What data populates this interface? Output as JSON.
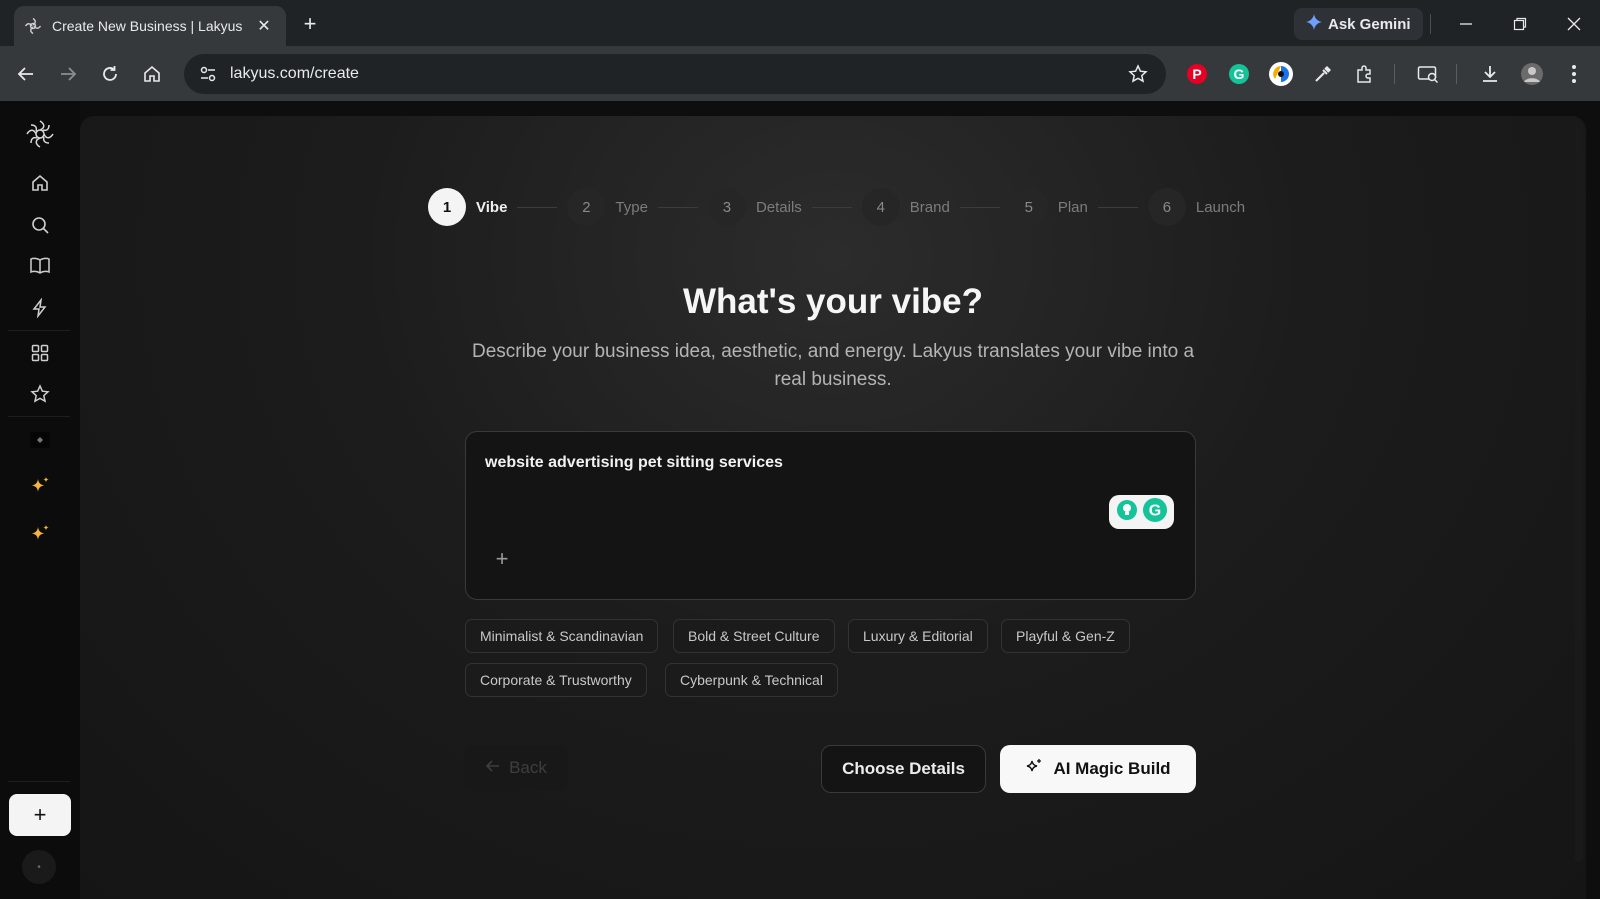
{
  "browser": {
    "tab_title": "Create New Business | Lakyus",
    "tab_close": "✕",
    "new_tab": "+",
    "ask_gemini": "Ask Gemini",
    "url": "lakyus.com/create"
  },
  "stepper": [
    {
      "number": "1",
      "label": "Vibe"
    },
    {
      "number": "2",
      "label": "Type"
    },
    {
      "number": "3",
      "label": "Details"
    },
    {
      "number": "4",
      "label": "Brand"
    },
    {
      "number": "5",
      "label": "Plan"
    },
    {
      "number": "6",
      "label": "Launch"
    }
  ],
  "main": {
    "heading": "What's your vibe?",
    "subheading": "Describe your business idea, aesthetic, and energy. Lakyus translates your vibe into a real business.",
    "prompt_value": "website advertising pet sitting services",
    "attach_label": "+",
    "chips": [
      "Minimalist & Scandinavian",
      "Bold & Street Culture",
      "Luxury & Editorial",
      "Playful & Gen-Z",
      "Corporate & Trustworthy",
      "Cyberpunk & Technical"
    ],
    "back_label": "Back",
    "choose_details_label": "Choose Details",
    "magic_build_label": "AI Magic Build"
  },
  "sidebar": {
    "new_label": "+"
  },
  "colors": {
    "accent_star": "#f5b43a",
    "pinterest": "#e60023",
    "grammarly": "#15c39a"
  }
}
